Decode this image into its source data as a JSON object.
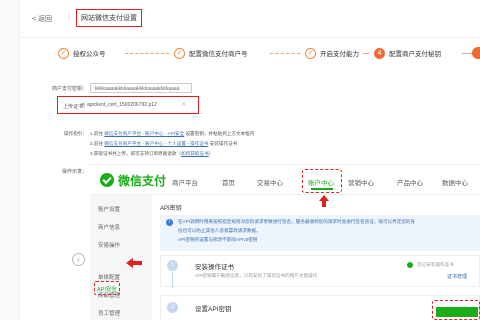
{
  "header": {
    "back": "< 返回",
    "separator": "|",
    "title": "网站微信支付设置"
  },
  "steps": [
    {
      "icon": "✓",
      "label": "授权公众号"
    },
    {
      "icon": "✓",
      "label": "配置微信支付商户号"
    },
    {
      "icon": "✓",
      "label": "开启支付能力"
    },
    {
      "icon": "4",
      "label": "配置商户支付秘钥"
    }
  ],
  "form": {
    "merchant_label": "商户支付密钥：",
    "merchant_value": "kkkkaaaakkkkaaaakkkkaaaakkkkaaaa",
    "cert_label": "上传证书：",
    "cert_file": "apiclient_cert_1500206792.p12",
    "cert_remove": "×"
  },
  "guide": {
    "label": "操作指引：",
    "line1": [
      "1.前往 ",
      "微信支付商户平台 - 账户中心 - API安全",
      " 设置密钥，并粘贴到上方文本框内"
    ],
    "line2": [
      "2.前往 ",
      "微信支付商户平台 - 账户中心 - 个人设置 - 操作证书",
      " 安装操作证书"
    ],
    "line3": [
      "3.获取证书并上传，即可支持订单原路退款（",
      "如何获取证书",
      "）"
    ],
    "example_label": "操作示意："
  },
  "wx": {
    "title": "微信支付",
    "nav": [
      "商户平台",
      "首页",
      "交易中心",
      "账户中心",
      "营销中心",
      "产品中心",
      "数据中心"
    ],
    "side": [
      "账户设置",
      "商户信息",
      "安易操作",
      "API安全",
      "单体配置",
      "商品管理",
      "员工管理"
    ],
    "api_title": "API密钥",
    "notice": [
      "在API调用时用来按照指定规则对您的请求参数进行签名，服务器收到您的请求时会进行签名验证，既可以界定您的身",
      "份也可以防止其他人恶意篡改请求数据。",
      "API密钥的设置与修改不影响APIv3密钥"
    ],
    "step1": {
      "num": "1",
      "title": "安装操作证书",
      "sub": "API密钥属于敏感信息，只有安装了操作证书的用户才能操作",
      "status": "您已安装操作证书",
      "manage": "证书管理"
    },
    "step2": {
      "num": "2",
      "title": "设置API密钥"
    }
  }
}
